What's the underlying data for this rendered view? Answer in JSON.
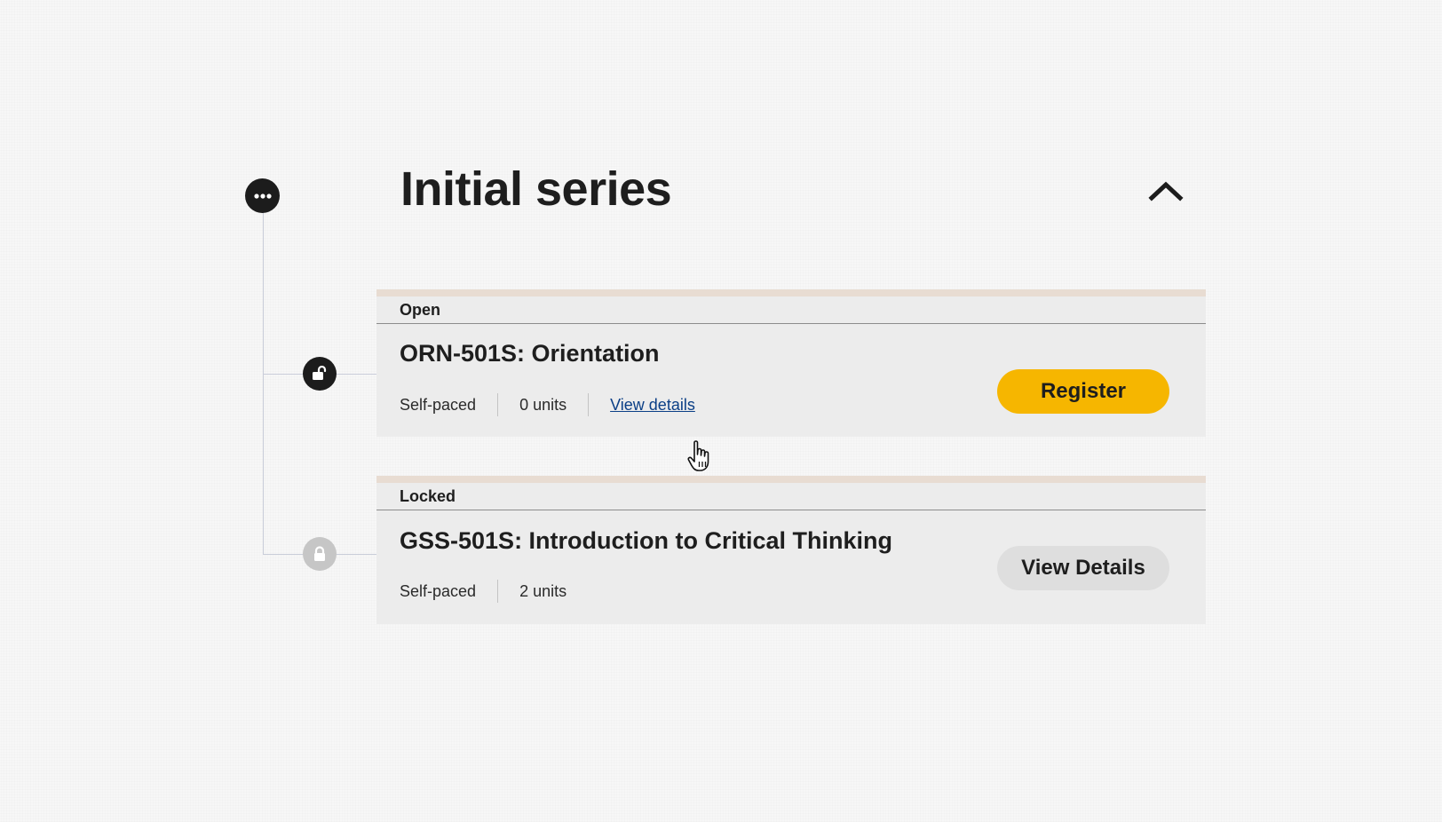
{
  "series": {
    "title": "Initial series"
  },
  "courses": [
    {
      "status": "Open",
      "title": "ORN-501S: Orientation",
      "pace": "Self-paced",
      "units": "0 units",
      "link_label": "View details",
      "button_label": "Register",
      "node_icon": "unlock-icon"
    },
    {
      "status": "Locked",
      "title": "GSS-501S: Introduction to Critical Thinking",
      "pace": "Self-paced",
      "units": "2 units",
      "button_label": "View Details",
      "node_icon": "lock-icon"
    }
  ],
  "colors": {
    "register_button": "#f6b600",
    "link": "#0b3f86",
    "card_background": "#ececec",
    "card_accent_bar": "#e8dcd2",
    "node_active": "#1c1c1c",
    "node_locked": "#c6c6c6"
  },
  "icons": {
    "series_node": "more-dots-icon",
    "collapse": "chevron-up-icon",
    "cursor": "hand-pointer-cursor"
  }
}
